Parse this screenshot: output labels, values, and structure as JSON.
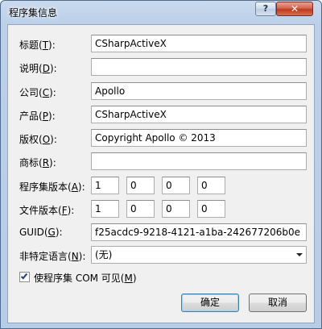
{
  "window": {
    "title": "程序集信息"
  },
  "titlebar": {
    "help_symbol": "?",
    "close_symbol": "✕"
  },
  "fields": {
    "title": {
      "label_pre": "标题(",
      "key": "T",
      "label_post": "):",
      "value": "CSharpActiveX"
    },
    "description": {
      "label_pre": "说明(",
      "key": "D",
      "label_post": "):",
      "value": ""
    },
    "company": {
      "label_pre": "公司(",
      "key": "C",
      "label_post": "):",
      "value": "Apollo"
    },
    "product": {
      "label_pre": "产品(",
      "key": "P",
      "label_post": "):",
      "value": "CSharpActiveX"
    },
    "copyright": {
      "label_pre": "版权(",
      "key": "O",
      "label_post": "):",
      "value": "Copyright Apollo ©  2013"
    },
    "trademark": {
      "label_pre": "商标(",
      "key": "R",
      "label_post": "):",
      "value": ""
    }
  },
  "assembly_version": {
    "label_pre": "程序集版本(",
    "key": "A",
    "label_post": "):",
    "parts": [
      "1",
      "0",
      "0",
      "0"
    ]
  },
  "file_version": {
    "label_pre": "文件版本(",
    "key": "F",
    "label_post": "):",
    "parts": [
      "1",
      "0",
      "0",
      "0"
    ]
  },
  "guid": {
    "label_pre": "GUID(",
    "key": "G",
    "label_post": "):",
    "value": "f25acdc9-9218-4121-a1ba-242677206b0e"
  },
  "neutral_language": {
    "label_pre": "非特定语言(",
    "key": "N",
    "label_post": "):",
    "selected": "(无)"
  },
  "com_visible": {
    "checked": true,
    "label_pre": "使程序集 COM 可见(",
    "key": "M",
    "label_post": ")"
  },
  "buttons": {
    "ok": "确定",
    "cancel": "取消"
  }
}
